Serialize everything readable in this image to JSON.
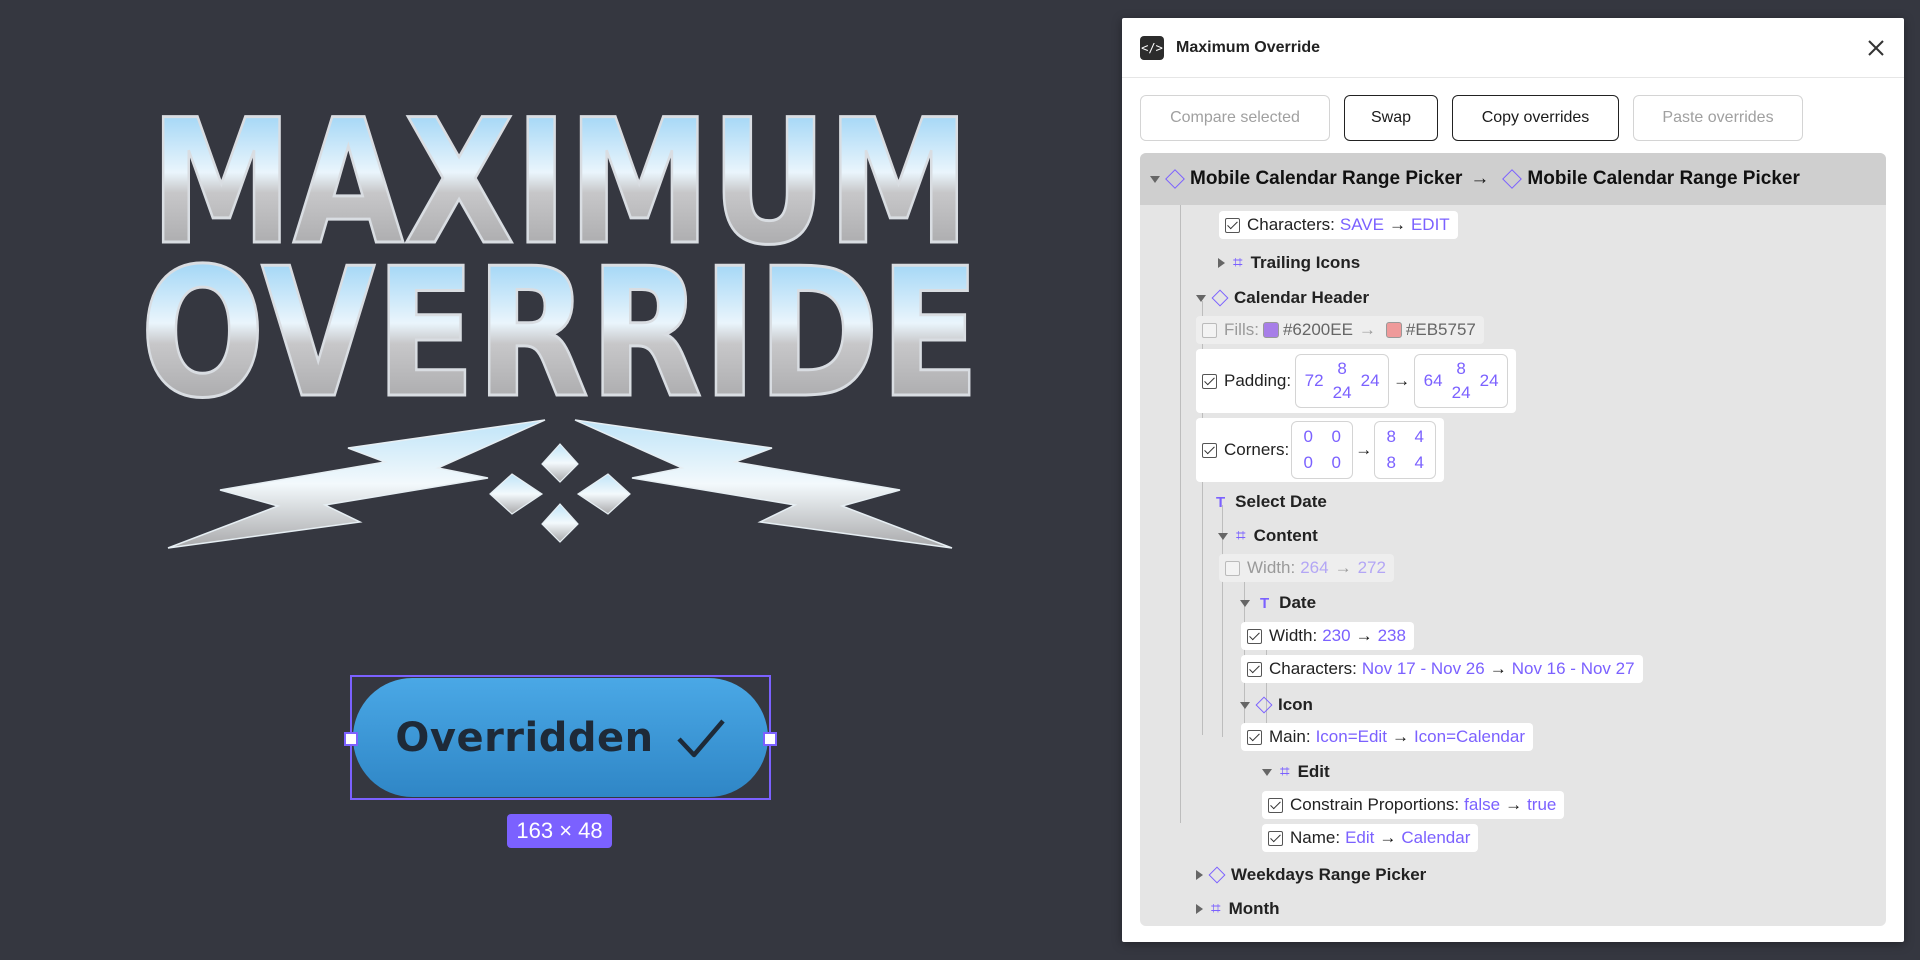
{
  "canvas": {
    "logo": {
      "line1": "MAXIMUM",
      "line2": "OVERRIDE"
    },
    "button": {
      "label": "Overridden"
    },
    "dimension_badge": "163 × 48"
  },
  "panel": {
    "title": "Maximum Override",
    "toolbar": {
      "compare": "Compare selected",
      "swap": "Swap",
      "copy": "Copy overrides",
      "paste": "Paste overrides"
    },
    "tree": {
      "root_left": "Mobile Calendar Range Picker",
      "root_right": "Mobile Calendar Range Picker",
      "arrow": "→",
      "characters_save": {
        "label": "Characters:",
        "from": "SAVE",
        "to": "EDIT"
      },
      "trailing_icons": "Trailing Icons",
      "calendar_header": "Calendar Header",
      "fills": {
        "label": "Fills:",
        "from": "#6200EE",
        "to": "#EB5757",
        "from_color": "#a77ee8",
        "to_color": "#ef9a9a"
      },
      "padding": {
        "label": "Padding:",
        "from": {
          "top": "8",
          "left": "72",
          "right": "24",
          "bottom": "24"
        },
        "to": {
          "top": "8",
          "left": "64",
          "right": "24",
          "bottom": "24"
        }
      },
      "corners": {
        "label": "Corners:",
        "from": [
          "0",
          "0",
          "0",
          "0"
        ],
        "to": [
          "8",
          "4",
          "8",
          "4"
        ]
      },
      "select_date": "Select Date",
      "content": "Content",
      "content_width": {
        "label": "Width:",
        "from": "264",
        "to": "272"
      },
      "date": "Date",
      "date_width": {
        "label": "Width:",
        "from": "230",
        "to": "238"
      },
      "date_characters": {
        "label": "Characters:",
        "from": "Nov 17 - Nov 26",
        "to": "Nov 16 - Nov 27"
      },
      "icon": "Icon",
      "icon_main": {
        "label": "Main:",
        "from": "Icon=Edit",
        "to": "Icon=Calendar"
      },
      "edit": "Edit",
      "constrain": {
        "label": "Constrain Proportions:",
        "from": "false",
        "to": "true"
      },
      "name": {
        "label": "Name:",
        "from": "Edit",
        "to": "Calendar"
      },
      "weekdays": "Weekdays Range Picker",
      "month": "Month"
    }
  }
}
